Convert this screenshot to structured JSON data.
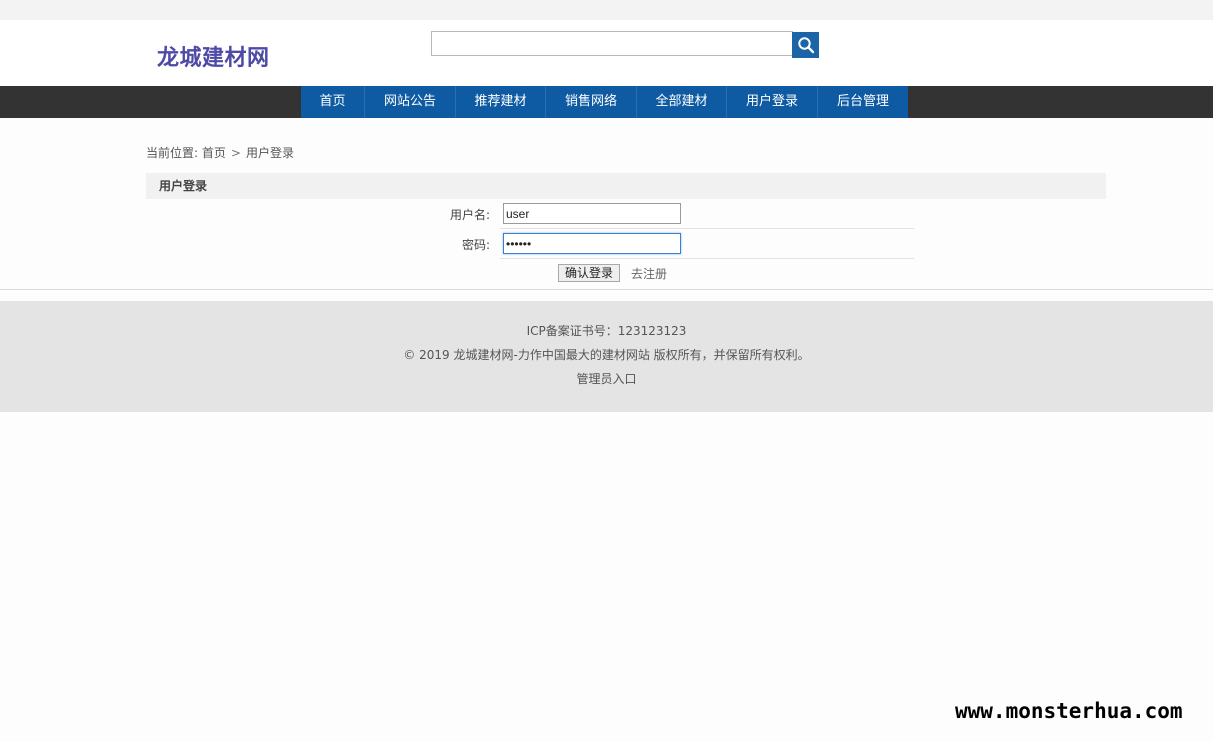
{
  "site": {
    "logo": "龙城建材网"
  },
  "search": {
    "value": "",
    "icon": "search-icon"
  },
  "nav": {
    "items": [
      {
        "label": "首页"
      },
      {
        "label": "网站公告"
      },
      {
        "label": "推荐建材"
      },
      {
        "label": "销售网络"
      },
      {
        "label": "全部建材"
      },
      {
        "label": "用户登录"
      },
      {
        "label": "后台管理"
      }
    ]
  },
  "breadcrumb": {
    "prefix": "当前位置:",
    "home": "首页",
    "separator": ">",
    "current": "用户登录"
  },
  "login": {
    "title": "用户登录",
    "username_label": "用户名:",
    "username_value": "user",
    "password_label": "密码:",
    "password_value": "••••••",
    "submit_label": "确认登录",
    "register_label": "去注册"
  },
  "footer": {
    "icp": "ICP备案证书号：123123123",
    "copyright": "© 2019 龙城建材网-力作中国最大的建材网站 版权所有，并保留所有权利。",
    "admin_entry": "管理员入口"
  },
  "watermark": "www.monsterhua.com",
  "colors": {
    "logo": "#4e4aa5",
    "nav_active": "#0f5ba3",
    "navbar_bg": "#333333",
    "search_button": "#1b64a6"
  }
}
